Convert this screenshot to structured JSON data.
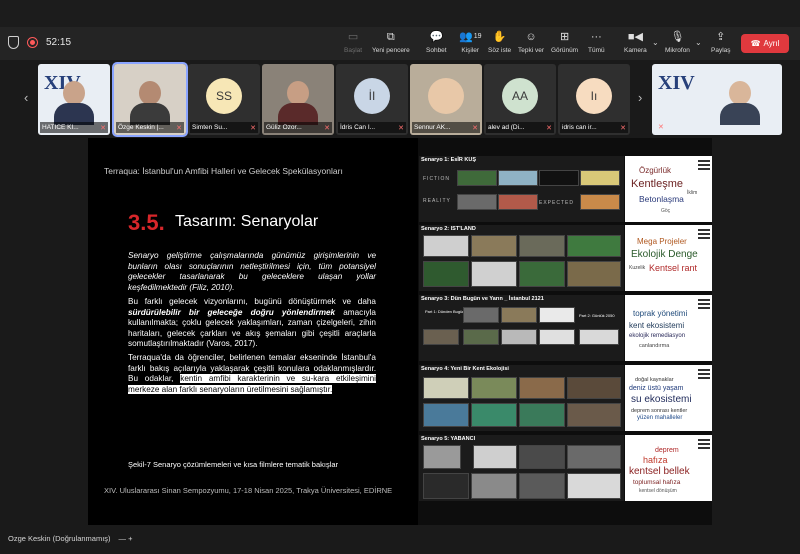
{
  "toolbar": {
    "timer": "52:15",
    "buttons": {
      "share": "Başlat",
      "new_window": "Yeni pencere",
      "chat": "Sohbet",
      "people": "Kişiler",
      "people_count": "19",
      "raise_hand": "Söz iste",
      "react": "Tepki ver",
      "view": "Görünüm",
      "more": "Tümü",
      "camera": "Kamera",
      "mic": "Mikrofon",
      "present": "Paylaş",
      "leave": "Ayrıl"
    }
  },
  "participants": [
    {
      "name": "HATICE KI...",
      "type": "banner",
      "banner_text": "XIV"
    },
    {
      "name": "Özge Keskin |...",
      "type": "video",
      "active": true
    },
    {
      "name": "Simten Su...",
      "type": "initials",
      "initials": "SS",
      "color": "#f7e7b6"
    },
    {
      "name": "Güliz Ozor...",
      "type": "video"
    },
    {
      "name": "İdris Can I...",
      "type": "initials",
      "initials": "İI",
      "color": "#c9d6e6"
    },
    {
      "name": "Sennur AK...",
      "type": "video"
    },
    {
      "name": "alev ad (Di...",
      "type": "initials",
      "initials": "AA",
      "color": "#cfe2cf"
    },
    {
      "name": "idris can ir...",
      "type": "initials",
      "initials": "Iı",
      "color": "#f7dcc0"
    },
    {
      "name": "",
      "type": "banner_video",
      "banner_text": "XIV"
    }
  ],
  "slide": {
    "header": "Terraqua: İstanbul'un Amfibi Halleri ve Gelecek Spekülasyonları",
    "section_num": "3.5.",
    "section_title": "Tasarım: Senaryolar",
    "para1": "Senaryo geliştirme çalışmalarında günümüz girişimlerinin ve bunların olası sonuçlarının netleştirilmesi için, tüm potansiyel gelecekler tasarlanarak bu geleceklere ulaşan yollar keşfedilmektedir (Filiz, 2010).",
    "para2_a": "Bu farklı gelecek vizyonlarını, bugünü dönüştürmek ve daha ",
    "para2_b": "sürdürülebilir bir geleceğe doğru yönlendirmek",
    "para2_c": " amacıyla kullanılmakta; çoklu gelecek yaklaşımları, zaman çizelgeleri, zihin haritaları, gelecek çarkları ve akış şemaları gibi çeşitli araçlarla somutlaştırılmaktadır (Varos, 2017).",
    "para3_a": "Terraqua'da da öğrenciler, belirlenen temalar ekseninde İstanbul'a farklı bakış açılarıyla yaklaşarak çeşitli konulara odaklanmışlardır. Bu odaklar, ",
    "para3_b": "kentin amfibi karakterinin ve su-kara etkileşimini merkeze alan farklı senaryoların üretilmesini sağlamıştır.",
    "caption": "Şekil-7 Senaryo çözümlemeleri ve kısa filmlere tematik bakışlar",
    "footer": "XIV. Uluslararası Sinan Sempozyumu, 17-18 Nisan 2025, Trakya Üniversitesi, EDİRNE",
    "scenarios": [
      {
        "title": "Senaryo 1: EsİR KUŞ",
        "labels": [
          "FICTION",
          "REALITY",
          "EXPECTED"
        ],
        "cloud": [
          "Özgürlük",
          "Kentleşme",
          "Betonlaşma",
          "İklim",
          "Göç"
        ]
      },
      {
        "title": "Senaryo 2: IST'LAND",
        "cloud": [
          "Mega Projeler",
          "Ekolojik Denge",
          "Kentsel rant",
          "Kuzelik"
        ]
      },
      {
        "title": "Senaryo 3: Dün Bugün ve Yarın _ İstanbul 2121",
        "labels": [
          "Part 1: Dünden Bugüne",
          "Part 2: Günlük 2050"
        ],
        "cloud": [
          "toprak yönetimi",
          "kent ekosistemi",
          "ekolojik remediasyon",
          "canlandırma"
        ]
      },
      {
        "title": "Senaryo 4: Yeni Bir Kent Ekolojisi",
        "cloud": [
          "doğal kaynaklar",
          "deniz üstü yaşam",
          "su ekosistemi",
          "deprem sonrası kentler",
          "yüzen mahalleler"
        ]
      },
      {
        "title": "Senaryo 5: YABANCI",
        "cloud": [
          "deprem",
          "hafıza",
          "kentsel bellek",
          "toplumsal hafıza",
          "kentsel dönüşüm"
        ]
      }
    ]
  },
  "bottom": {
    "owner": "Ozge Keskin (Doğrulanmamış)",
    "controls": "— +"
  },
  "colors": {
    "accent_red": "#d7262a",
    "leave_red": "#e0393e",
    "active_outline": "#8aa4ff"
  }
}
